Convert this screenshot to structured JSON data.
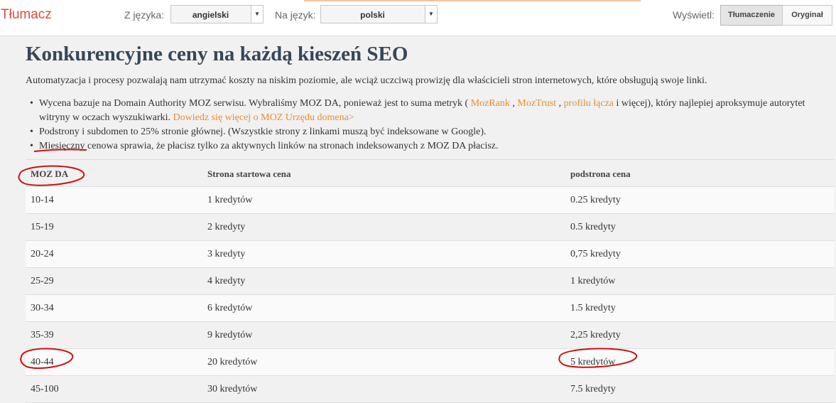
{
  "toolbar": {
    "brand": "Tłumacz",
    "from_label": "Z języka:",
    "from_value": "angielski",
    "to_label": "Na język:",
    "to_value": "polski",
    "show_label": "Wyświetl:",
    "translation_button": "Tłumaczenie",
    "original_button": "Oryginał"
  },
  "page": {
    "title": "Konkurencyjne ceny na każdą kieszeń SEO",
    "intro": "Automatyzacja i procesy pozwalają nam utrzymać koszty na niskim poziomie, ale wciąż uczciwą prowizję dla właścicieli stron internetowych, które obsługują swoje linki.",
    "bullet1_a": "Wycena bazuje na Domain Authority MOZ serwisu. Wybraliśmy MOZ DA, ponieważ jest to suma metryk ( ",
    "bullet1_link1": "MozRank",
    "bullet1_sep1": " , ",
    "bullet1_link2": "MozTrust",
    "bullet1_sep2": " , ",
    "bullet1_link3": "profilu łącza",
    "bullet1_b": " i więcej), który najlepiej aproksymuje autorytet witryny w oczach wyszukiwarki. ",
    "bullet1_link4": "Dowiedz się więcej o MOZ Urzędu domena>",
    "bullet2": "Podstrony i subdomen to 25% stronie głównej. (Wszystkie strony z linkami muszą być indeksowane w Google).",
    "bullet3_word": "Miesięczny",
    "bullet3_rest": " cenowa sprawia, że płacisz tylko za aktywnych linków na stronach indeksowanych z MOZ DA płacisz."
  },
  "table": {
    "headers": [
      "MOZ DA",
      "Strona startowa cena",
      "podstrona cena"
    ],
    "rows": [
      [
        "10-14",
        "1 kredytów",
        "0.25 kredyty"
      ],
      [
        "15-19",
        "2 kredyty",
        "0.5 kredyty"
      ],
      [
        "20-24",
        "3 kredyty",
        "0,75 kredyty"
      ],
      [
        "25-29",
        "4 kredyty",
        "1 kredytów"
      ],
      [
        "30-34",
        "6 kredytów",
        "1.5 kredyty"
      ],
      [
        "35-39",
        "9 kredytów",
        "2,25 kredyty"
      ],
      [
        "40-44",
        "20 kredytów",
        "5 kredytów"
      ],
      [
        "45-100",
        "30 kredytów",
        "7.5 kredyty"
      ]
    ]
  },
  "colors": {
    "brand": "#dd4b39",
    "heading": "#35475a",
    "link": "#e88f2b",
    "annotation": "#cc1111"
  }
}
